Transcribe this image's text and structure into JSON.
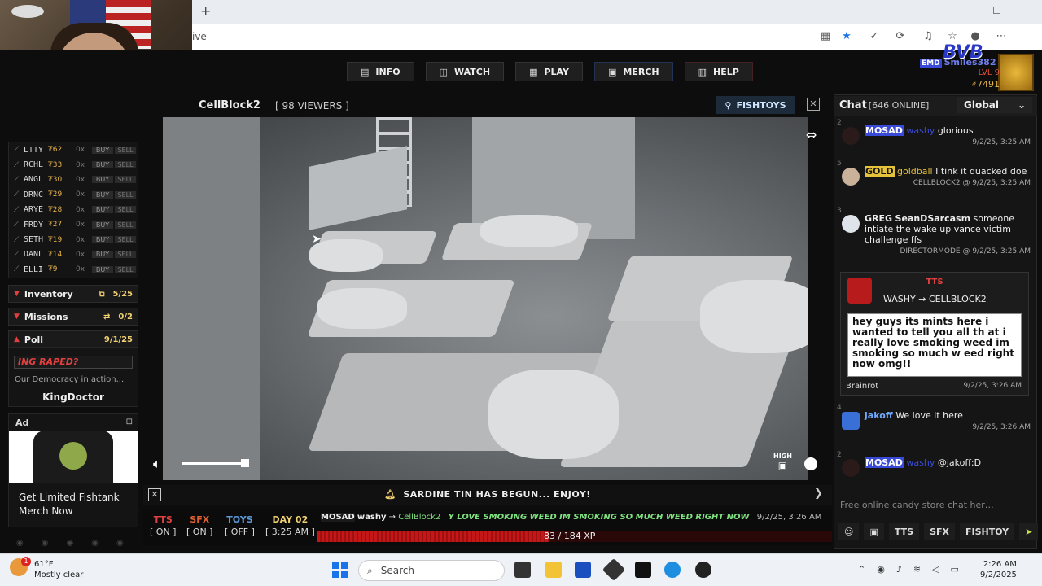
{
  "browser": {
    "new_tab": "+",
    "url_fragment": "ive",
    "window_controls": [
      "—",
      "☐"
    ]
  },
  "site": {
    "nav": [
      {
        "icon": "info-icon",
        "glyph": "▤",
        "label": "INFO"
      },
      {
        "icon": "watch-icon",
        "glyph": "◫",
        "label": "WATCH"
      },
      {
        "icon": "play-icon",
        "glyph": "▦",
        "label": "PLAY"
      },
      {
        "icon": "merch-icon",
        "glyph": "▣",
        "label": "MERCH"
      },
      {
        "icon": "help-icon",
        "glyph": "▥",
        "label": "HELP"
      }
    ],
    "user": {
      "badge": "EMD",
      "name": "Smiles382",
      "overlay": "BVB",
      "level": "LVL 9",
      "coins": "₮7491"
    }
  },
  "stocks": [
    {
      "ticker": "LTTY",
      "price": "₮62",
      "qty": "0x",
      "buy": "BUY",
      "sell": "SELL"
    },
    {
      "ticker": "RCHL",
      "price": "₮33",
      "qty": "0x",
      "buy": "BUY",
      "sell": "SELL"
    },
    {
      "ticker": "ANGL",
      "price": "₮30",
      "qty": "0x",
      "buy": "BUY",
      "sell": "SELL"
    },
    {
      "ticker": "DRNC",
      "price": "₮29",
      "qty": "0x",
      "buy": "BUY",
      "sell": "SELL"
    },
    {
      "ticker": "ARYE",
      "price": "₮28",
      "qty": "0x",
      "buy": "BUY",
      "sell": "SELL"
    },
    {
      "ticker": "FRDY",
      "price": "₮27",
      "qty": "0x",
      "buy": "BUY",
      "sell": "SELL"
    },
    {
      "ticker": "SETH",
      "price": "₮19",
      "qty": "0x",
      "buy": "BUY",
      "sell": "SELL"
    },
    {
      "ticker": "DANL",
      "price": "₮14",
      "qty": "0x",
      "buy": "BUY",
      "sell": "SELL"
    },
    {
      "ticker": "ELLI",
      "price": "₮9",
      "qty": "0x",
      "buy": "BUY",
      "sell": "SELL"
    }
  ],
  "sections": {
    "inventory": {
      "label": "Inventory",
      "count": "5/25"
    },
    "missions": {
      "label": "Missions",
      "count": "0/2"
    },
    "poll": {
      "label": "Poll",
      "date": "9/1/25",
      "question": "ING RAPED?",
      "description": "Our Democracy in action...",
      "winner": "KingDoctor"
    }
  },
  "ad": {
    "label": "Ad",
    "text": "Get Limited Fishtank Merch Now"
  },
  "video": {
    "room": "CellBlock2",
    "viewers": "[ 98 VIEWERS ]",
    "fishtoys": "FISHTOYS",
    "quality": "HIGH",
    "announcement": "SARDINE TIN HAS BEGUN... ENJOY!"
  },
  "status": {
    "tts": {
      "label": "TTS",
      "state": "[ ON ]"
    },
    "sfx": {
      "label": "SFX",
      "state": "[ ON ]"
    },
    "toys": {
      "label": "TOYS",
      "state": "[ OFF ]"
    },
    "day": {
      "label": "DAY 02",
      "state": "[ 3:25 AM ]"
    },
    "feed": {
      "badge": "MOSAD",
      "sender": "washy",
      "arrow": "→",
      "target": "CellBlock2",
      "message": "Y LOVE SMOKING WEED IM SMOKING SO MUCH WEED RIGHT NOW",
      "time": "9/2/25, 3:26 AM"
    },
    "xp": {
      "current": 83,
      "max": 184,
      "text": "83 / 184 XP"
    }
  },
  "chat": {
    "title": "Chat",
    "online": "[646 ONLINE]",
    "channel": "Global",
    "messages": [
      {
        "num": "2",
        "badge": "MOSAD",
        "user": "washy",
        "text": "glorious",
        "time": "9/2/25, 3:25 AM"
      },
      {
        "num": "5",
        "badge": "GOLD",
        "user": "goldball",
        "text": "I tink it quacked doe",
        "time": "CELLBLOCK2 @ 9/2/25, 3:25 AM"
      },
      {
        "num": "3",
        "badge": "GREG",
        "user": "SeanDSarcasm",
        "text": "someone intiate the wake up vance victim challenge ffs",
        "time": "DIRECTORMODE @ 9/2/25, 3:25 AM"
      },
      {
        "num": "4",
        "badge": "",
        "user": "jakoff",
        "text": "We love it here",
        "time": "9/2/25, 3:26 AM"
      },
      {
        "num": "2",
        "badge": "MOSAD",
        "user": "washy",
        "text": "@jakoff:D",
        "time": ""
      }
    ],
    "tts": {
      "label": "TTS",
      "from": "WASHY",
      "arrow": "→",
      "to": "CELLBLOCK2",
      "text": "hey guys its mints here i wanted to tell you all th at i really love smoking weed im smoking so much w eed right now omg!!",
      "voice": "Brainrot",
      "time": "9/2/25, 3:26 AM"
    },
    "input_placeholder": "Free online candy store chat her…",
    "buttons": [
      "TTS",
      "SFX",
      "FISHTOY"
    ]
  },
  "taskbar": {
    "temp": "61°F",
    "weather": "Mostly clear",
    "badge": "1",
    "search": "Search",
    "time": "2:26 AM",
    "date": "9/2/2025"
  },
  "colors": {
    "accent_red": "#e04040",
    "gold": "#e6b34a",
    "green_msg": "#7fe07f",
    "mosad_blue": "#3a4ad8"
  }
}
